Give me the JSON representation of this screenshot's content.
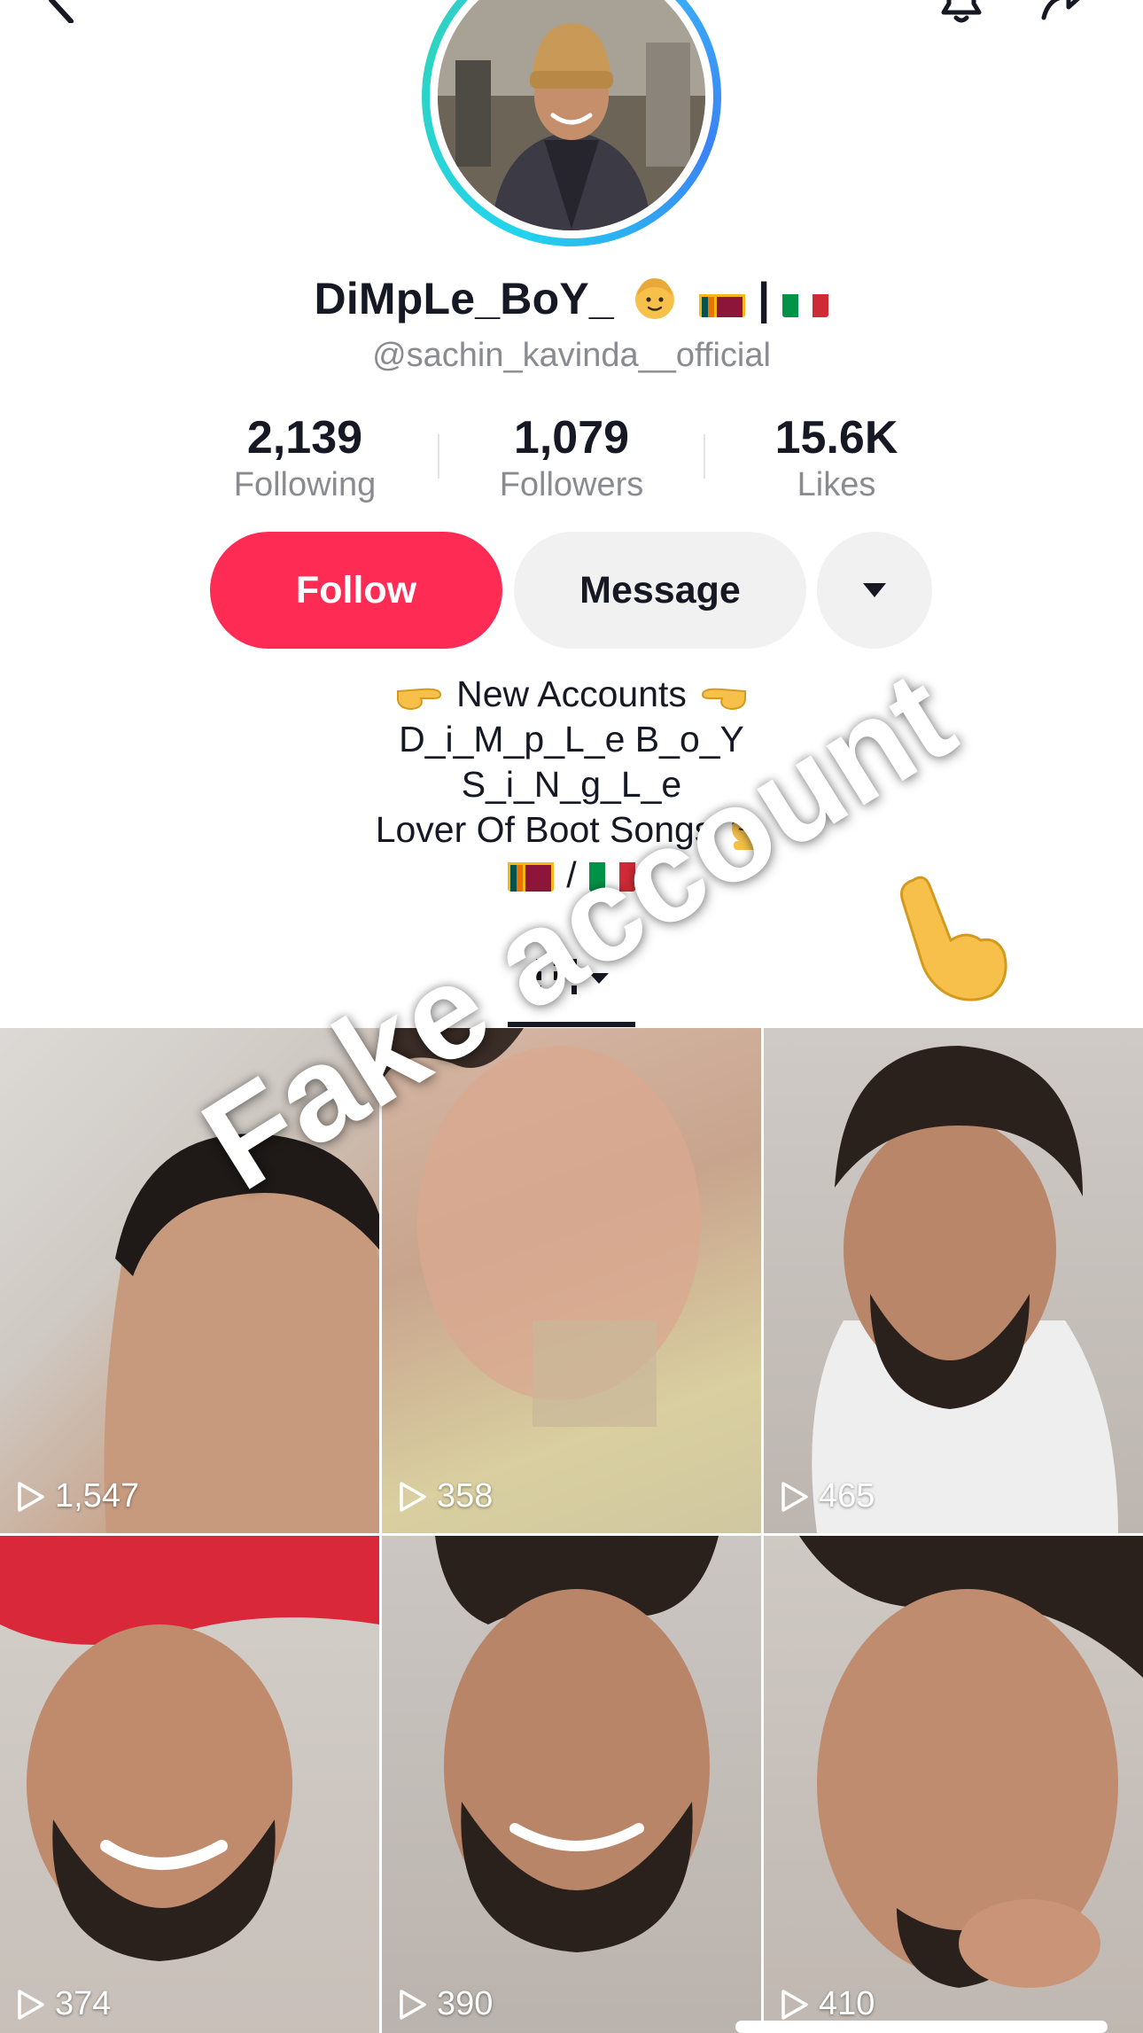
{
  "profile": {
    "display_name": "DiMpLe_BoY_",
    "separator": "|",
    "username": "@sachin_kavinda__official"
  },
  "stats": [
    {
      "value": "2,139",
      "label": "Following"
    },
    {
      "value": "1,079",
      "label": "Followers"
    },
    {
      "value": "15.6K",
      "label": "Likes"
    }
  ],
  "actions": {
    "follow_label": "Follow",
    "message_label": "Message"
  },
  "bio": {
    "line1": "New Accounts",
    "line2": "D_i_M_p_L_e B_o_Y",
    "line3": "S_i_N_g_L_e",
    "line4": "Lover Of Boot Songs",
    "line5_separator": "/"
  },
  "videos": [
    {
      "views": "1,547"
    },
    {
      "views": "358"
    },
    {
      "views": "465"
    },
    {
      "views": "374"
    },
    {
      "views": "390"
    },
    {
      "views": "410"
    }
  ],
  "overlay": {
    "text": "Fake account"
  },
  "colors": {
    "follow_button": "#fe2c55",
    "secondary_button": "#f1f1f2",
    "muted_text": "#8a8b91"
  },
  "icons": [
    "back-icon",
    "bell-icon",
    "share-icon",
    "dropdown-arrow-icon",
    "grid-icon",
    "play-icon",
    "pointing-hand-icon"
  ]
}
